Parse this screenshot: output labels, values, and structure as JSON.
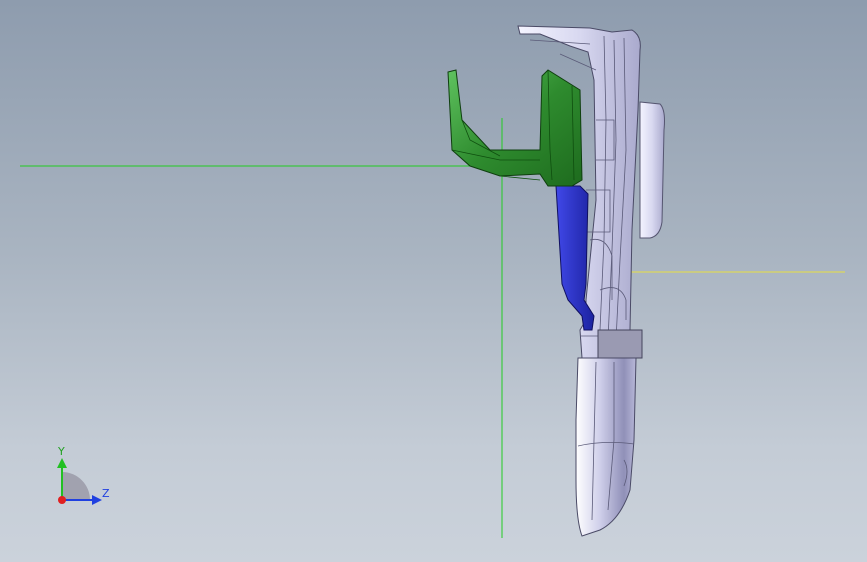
{
  "viewport": {
    "background_top": "#8e9cae",
    "background_bottom": "#cbd2db"
  },
  "reference_lines": {
    "horizontal_color": "#22cc22",
    "vertical_color": "#22cc22",
    "yellow_color": "#e8e040"
  },
  "model": {
    "green_part_color": "#2e8b2e",
    "blue_part_color": "#2830c8",
    "shell_color": "#dcdcf2"
  },
  "triad": {
    "y_label": "Y",
    "z_label": "Z",
    "y_color": "#22c022",
    "z_color": "#2040e0",
    "x_color": "#e02020"
  }
}
